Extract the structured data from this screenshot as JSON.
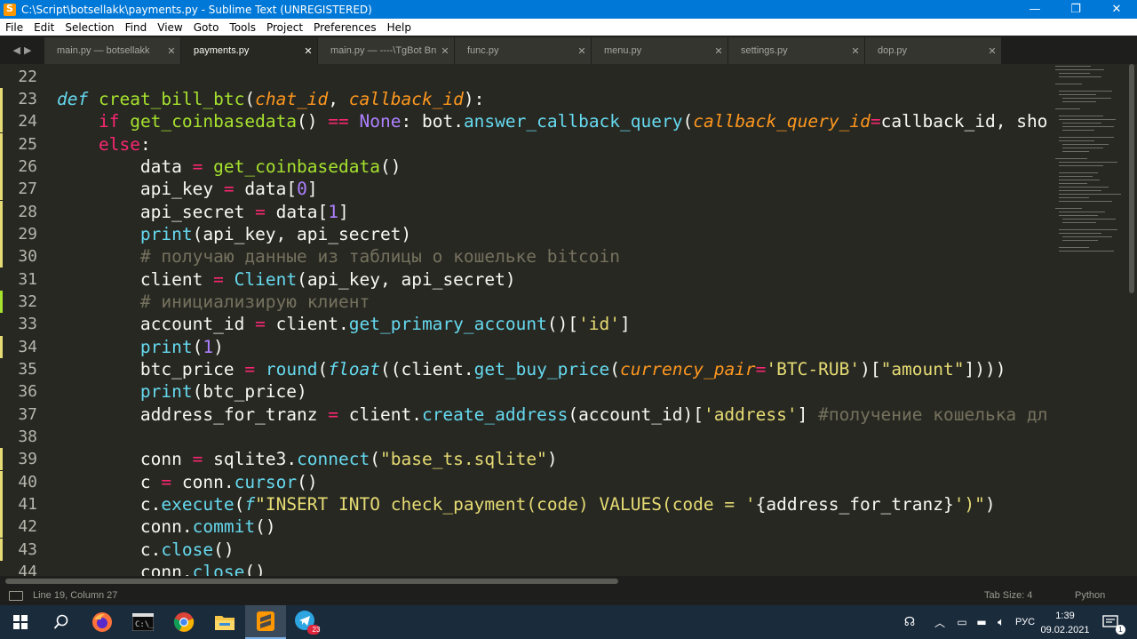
{
  "window": {
    "title": "C:\\Script\\botsellakk\\payments.py - Sublime Text (UNREGISTERED)",
    "minimize": "—",
    "maximize": "❐",
    "close": "✕"
  },
  "menu": [
    "File",
    "Edit",
    "Selection",
    "Find",
    "View",
    "Goto",
    "Tools",
    "Project",
    "Preferences",
    "Help"
  ],
  "tabs": [
    {
      "label": "main.py — botsellakk",
      "active": false
    },
    {
      "label": "payments.py",
      "active": true
    },
    {
      "label": "main.py — ----\\TgBot Bruter",
      "active": false
    },
    {
      "label": "func.py",
      "active": false
    },
    {
      "label": "menu.py",
      "active": false
    },
    {
      "label": "settings.py",
      "active": false
    },
    {
      "label": "dop.py",
      "active": false
    }
  ],
  "tab_close_glyph": "✕",
  "tab_nav": {
    "left": "◀",
    "right": "▶"
  },
  "line_numbers": [
    "22",
    "23",
    "24",
    "25",
    "26",
    "27",
    "28",
    "29",
    "30",
    "31",
    "32",
    "33",
    "34",
    "35",
    "36",
    "37",
    "38",
    "39",
    "40",
    "41",
    "42",
    "43",
    "44"
  ],
  "code_text": {
    "l23_def": "def",
    "l23_name": "creat_bill_btc",
    "l23_p1": "chat_id",
    "l23_p2": "callback_id",
    "l24_if": "if",
    "l24_fn": "get_coinbasedata",
    "l24_eq": "==",
    "l24_none": "None",
    "l24_bot": "bot.",
    "l24_m": "answer_callback_query",
    "l24_kw": "callback_query_id",
    "l24_tail": "callback_id, sho",
    "l25_else": "else",
    "l26_a": "data",
    "l26_fn": "get_coinbasedata",
    "l27_a": "api_key",
    "l27_b": "data[",
    "l27_n": "0",
    "l28_a": "api_secret",
    "l28_b": "data[",
    "l28_n": "1",
    "l29_fn": "print",
    "l29_args": "(api_key, api_secret)",
    "l30_cm": "# получаю данные из таблицы о кошельке bitcoin",
    "l31_a": "client",
    "l31_fn": "Client",
    "l31_args": "(api_key, api_secret)",
    "l32_cm": "# инициализирую клиент",
    "l33_a": "account_id",
    "l33_b": "client.",
    "l33_m": "get_primary_account",
    "l33_s": "'id'",
    "l34_fn": "print",
    "l34_n": "1",
    "l35_a": "btc_price",
    "l35_round": "round",
    "l35_float": "float",
    "l35_b": "((client.",
    "l35_m": "get_buy_price",
    "l35_kw": "currency_pair",
    "l35_s1": "'BTC-RUB'",
    "l35_s2": "\"amount\"",
    "l36_fn": "print",
    "l36_args": "(btc_price)",
    "l37_a": "address_for_tranz",
    "l37_b": "client.",
    "l37_m": "create_address",
    "l37_args": "(account_id)[",
    "l37_s": "'address'",
    "l37_cm": "#получение кошелька дл",
    "l39_a": "conn",
    "l39_b": "sqlite3.",
    "l39_m": "connect",
    "l39_s": "\"base_ts.sqlite\"",
    "l40_a": "c",
    "l40_b": "conn.",
    "l40_m": "cursor",
    "l41_b": "c.",
    "l41_m": "execute",
    "l41_f": "f",
    "l41_s1": "\"INSERT INTO check_payment(code) VALUES(code = '",
    "l41_interp": "{address_for_tranz}",
    "l41_s2": "')\"",
    "l42_b": "conn.",
    "l42_m": "commit",
    "l43_b": "c.",
    "l43_m": "close",
    "l44_b": "conn.",
    "l44_m": "close"
  },
  "status": {
    "position": "Line 19, Column 27",
    "tab_size": "Tab Size: 4",
    "syntax": "Python"
  },
  "taskbar": {
    "apps": [
      "start-icon",
      "search-icon",
      "firefox-icon",
      "terminal-icon",
      "chrome-icon",
      "file-explorer-icon",
      "sublime-text-icon",
      "telegram-icon"
    ],
    "telegram_badge": "23",
    "language": "РУС",
    "time": "1:39",
    "date": "09.02.2021"
  },
  "colors": {
    "background": "#272822",
    "keyword": "#66d9ef",
    "function": "#a6e22e",
    "operator": "#f92672",
    "parameter": "#fd971f",
    "constant": "#ae81ff",
    "string": "#e6db74",
    "comment": "#75715e"
  }
}
